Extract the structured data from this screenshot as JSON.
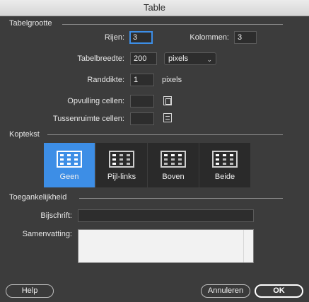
{
  "window": {
    "title": "Table"
  },
  "table_size": {
    "section_label": "Tabelgrootte",
    "rows_label": "Rijen:",
    "rows_value": "3",
    "columns_label": "Kolommen:",
    "columns_value": "3",
    "width_label": "Tabelbreedte:",
    "width_value": "200",
    "width_unit": "pixels",
    "border_label": "Randdikte:",
    "border_value": "1",
    "border_unit": "pixels",
    "padding_label": "Opvulling cellen:",
    "padding_value": "",
    "spacing_label": "Tussenruimte cellen:",
    "spacing_value": ""
  },
  "header": {
    "section_label": "Koptekst",
    "options": [
      {
        "label": "Geen",
        "icon": "table-no-header-icon",
        "selected": true
      },
      {
        "label": "Pijl-links",
        "icon": "table-left-header-icon",
        "selected": false
      },
      {
        "label": "Boven",
        "icon": "table-top-header-icon",
        "selected": false
      },
      {
        "label": "Beide",
        "icon": "table-both-header-icon",
        "selected": false
      }
    ]
  },
  "accessibility": {
    "section_label": "Toegankelijkheid",
    "caption_label": "Bijschrift:",
    "caption_value": "",
    "summary_label": "Samenvatting:",
    "summary_value": ""
  },
  "footer": {
    "help_label": "Help",
    "cancel_label": "Annuleren",
    "ok_label": "OK"
  },
  "colors": {
    "background": "#3c3c3c",
    "accent": "#3d8ee6",
    "field_bg": "#2d2d2d"
  }
}
